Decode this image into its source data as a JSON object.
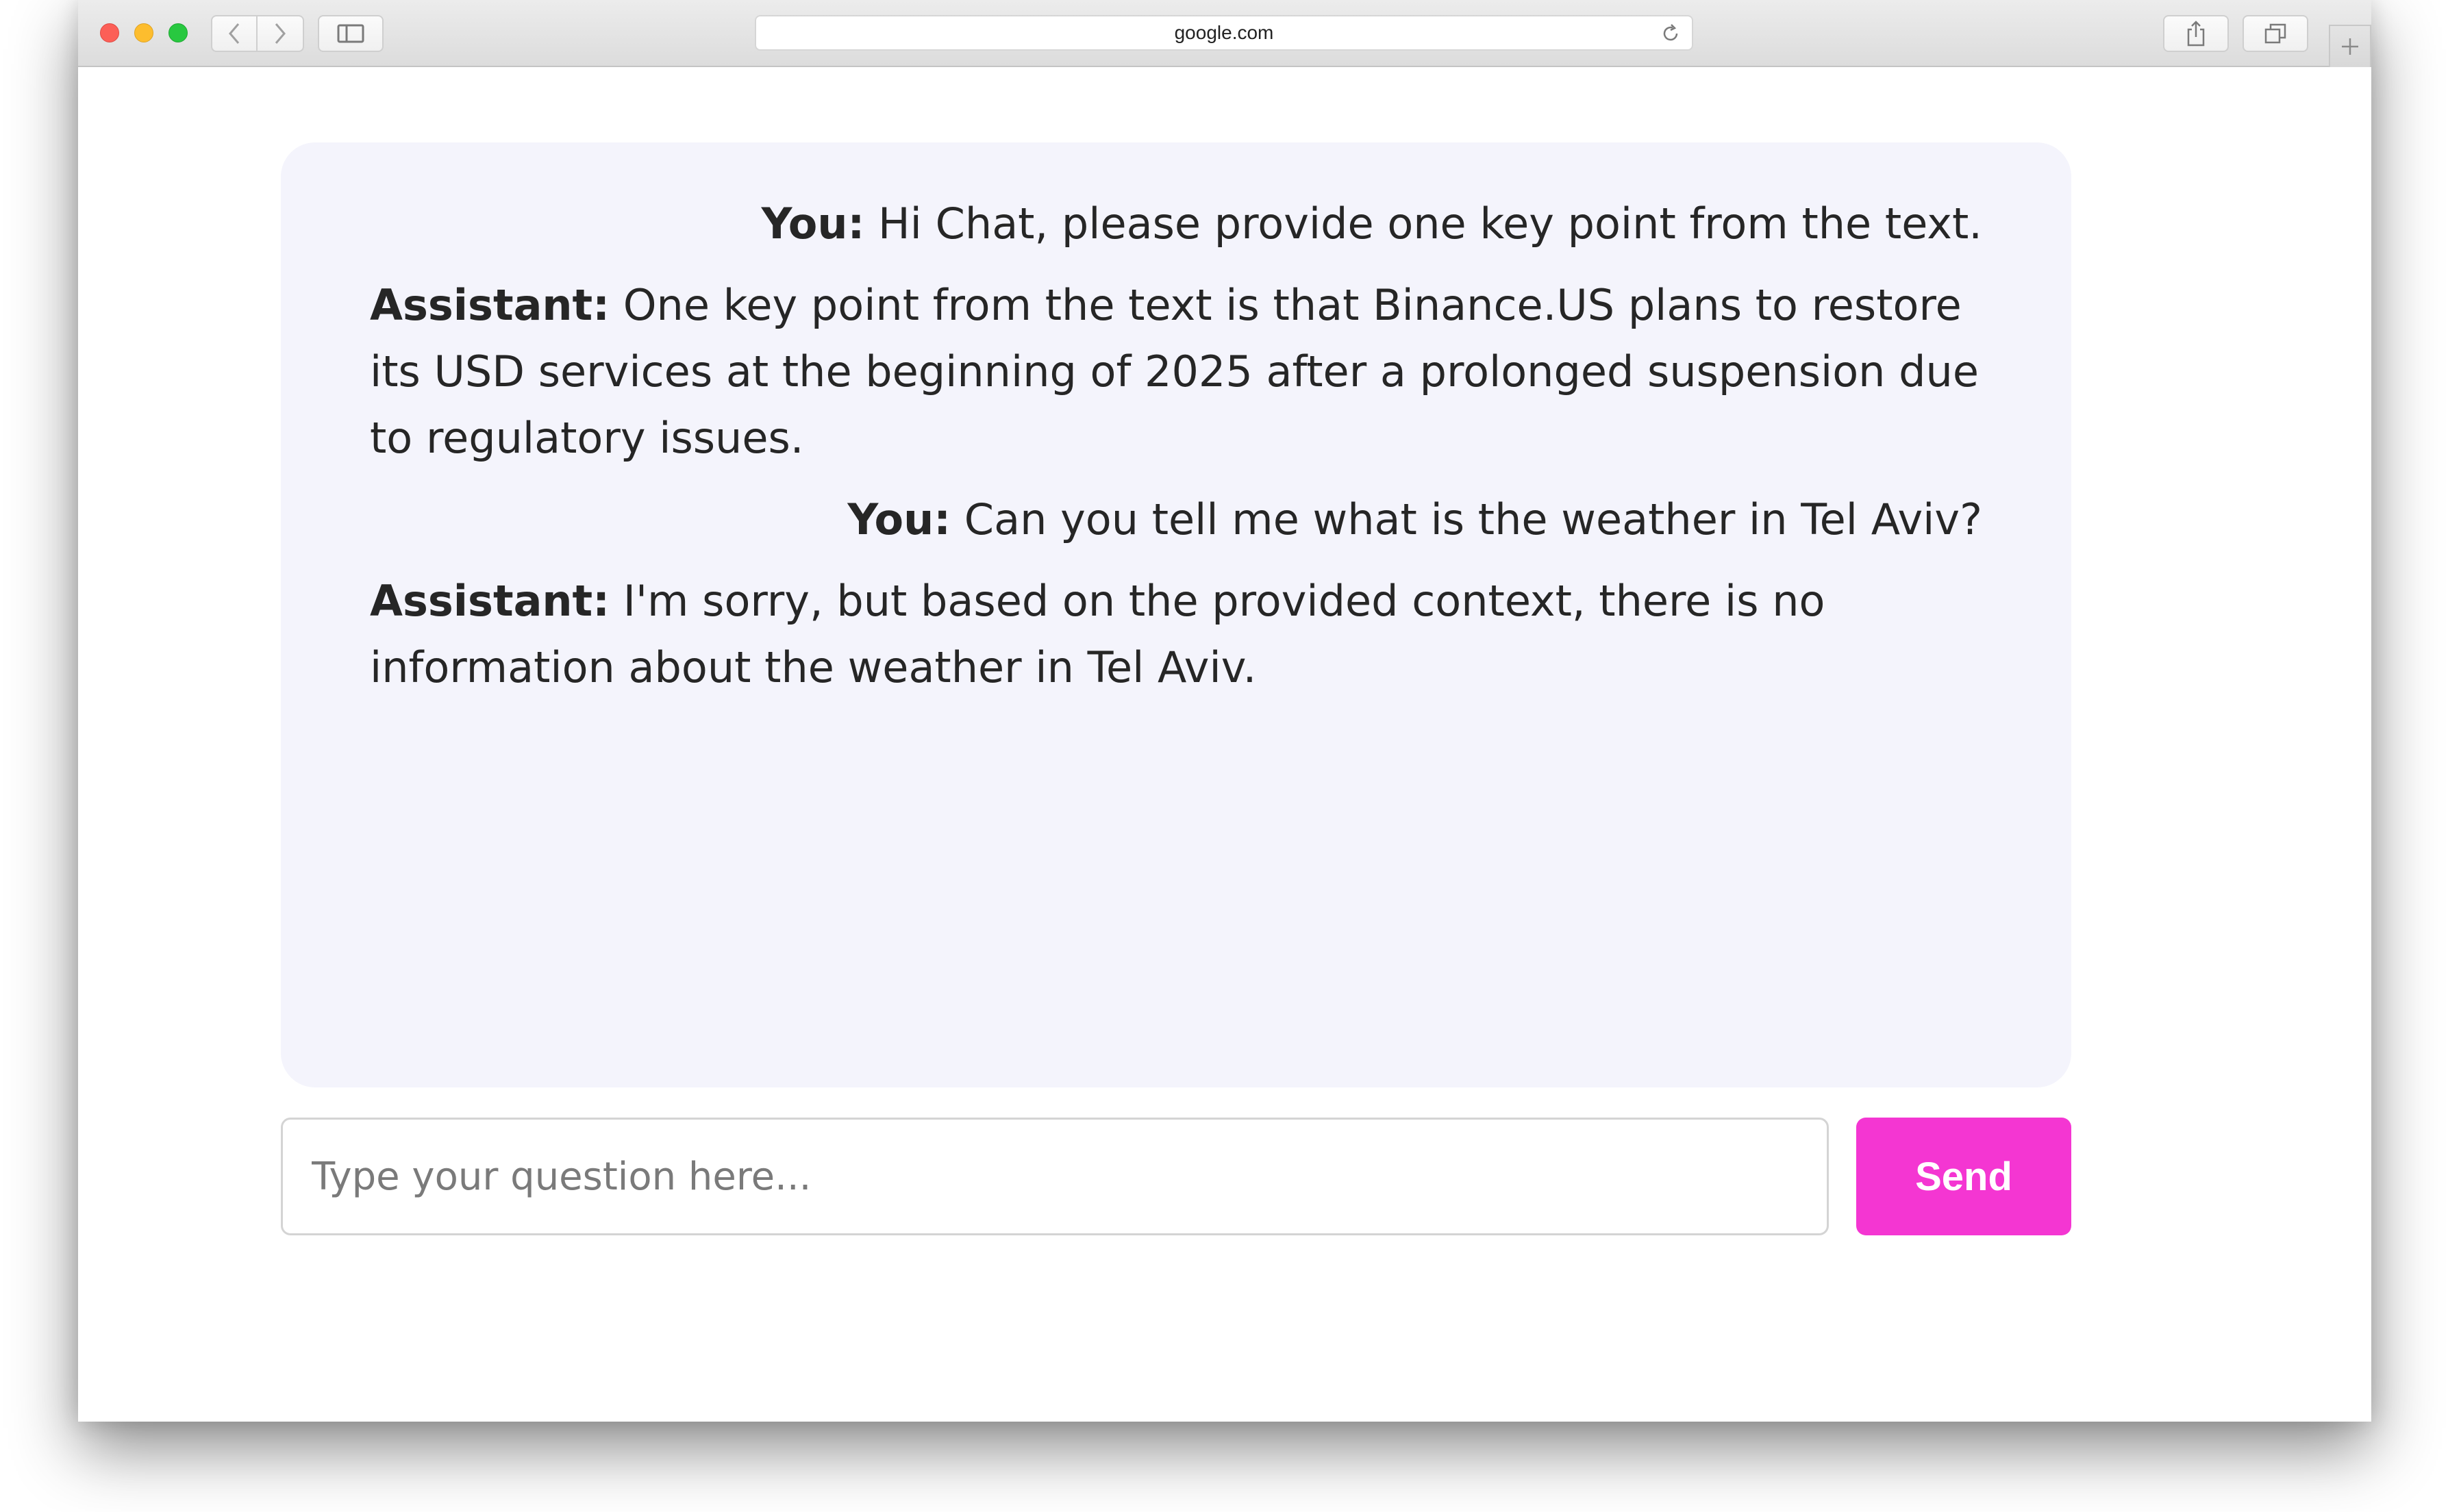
{
  "browser": {
    "url": "google.com",
    "icons": {
      "back": "chevron-left-icon",
      "forward": "chevron-right-icon",
      "sidebar": "sidebar-icon",
      "reload": "reload-icon",
      "share": "share-icon",
      "tabs": "tabs-icon",
      "new_tab": "plus-icon"
    }
  },
  "chat": {
    "messages": [
      {
        "role": "user",
        "speaker": "You:",
        "text": "Hi Chat, please provide one key point from the text."
      },
      {
        "role": "assistant",
        "speaker": "Assistant:",
        "text": "One key point from the text is that Binance.US plans to restore its USD services at the beginning of 2025 after a prolonged suspension due to regulatory issues."
      },
      {
        "role": "user",
        "speaker": "You:",
        "text": "Can you tell me what is the weather in Tel Aviv?"
      },
      {
        "role": "assistant",
        "speaker": "Assistant:",
        "text": "I'm sorry, but based on the provided context, there is no information about the weather in Tel Aviv."
      }
    ]
  },
  "input": {
    "placeholder": "Type your question here...",
    "value": ""
  },
  "send_button": {
    "label": "Send",
    "color": "#f436d2"
  },
  "colors": {
    "panel_background": "#f4f4fc",
    "text": "#262626"
  }
}
